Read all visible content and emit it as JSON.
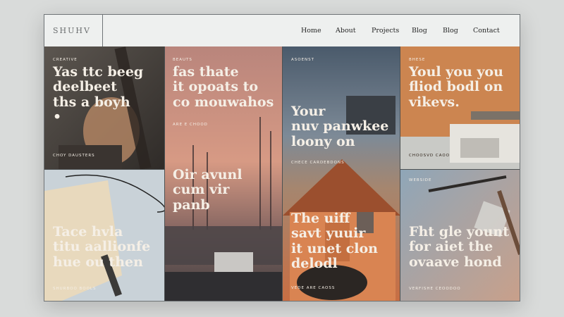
{
  "brand": {
    "logo": "SHUHV"
  },
  "nav": {
    "items": [
      "Home",
      "About",
      "Projects",
      "Blog",
      "Blog",
      "Contact"
    ]
  },
  "panels": [
    {
      "tag": "CREATIVE",
      "heading": "Yas ttc beeg\ndeelbeet\nths a boyh\n•",
      "caption": "CHOY DAUSTERS"
    },
    {
      "tag": "BEAUTS",
      "heading": "fas thate\nit opoats to\nco mouwahos",
      "caption": "ARE E CHOOD"
    },
    {
      "tag": "ASOENST",
      "heading": "Your\nnuv panwkee\nloony on",
      "caption": "CHECE CARDEBDONS"
    },
    {
      "tag": "BHESE",
      "heading": "Youl you you\nfliod bodl on\nvikevs.",
      "caption": "CHOOSVD CAOO"
    },
    {
      "heading": "Oir avunl\ncum vir\npanb",
      "caption": ""
    },
    {
      "tag": "",
      "heading": "Tace hvla\ntitu aallionfe\nhue ou then",
      "caption": "SHURBOO BOOLS"
    },
    {
      "heading": "The uiff\nsavt yuuir\nit unet clon\ndelodl",
      "caption": "VEDE ARE CAOSS"
    },
    {
      "tag": "WEBSIDE",
      "heading": "Fht gle yount\nfor aiet the\novaave hond",
      "caption": "VERFISHE CEOODOO"
    }
  ],
  "colors": {
    "panel1": "#4e4a46",
    "panel2": "#c58a7a",
    "panel3": "#5c6b7b",
    "panel4": "#c9824d",
    "panel6": "#c7d0d6",
    "panel7": "#cf7a4c",
    "panel8": "#8fa3b5"
  }
}
